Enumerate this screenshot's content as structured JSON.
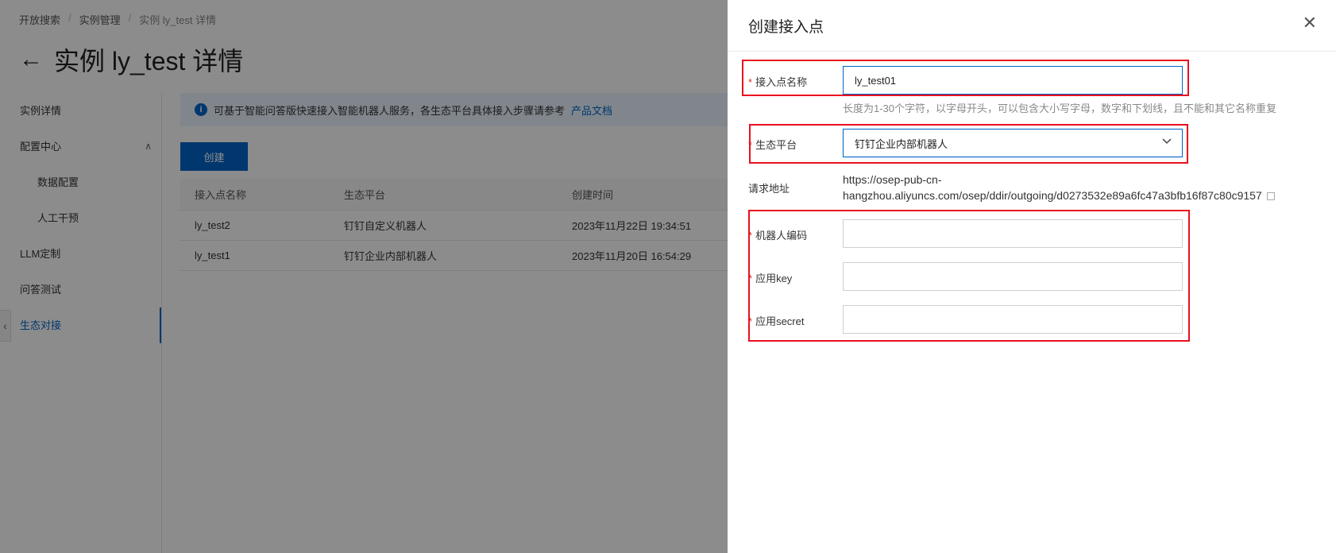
{
  "breadcrumb": [
    "开放搜索",
    "实例管理",
    "实例 ly_test 详情"
  ],
  "page_title": "实例 ly_test 详情",
  "sidebar": {
    "items": [
      {
        "label": "实例详情"
      },
      {
        "label": "配置中心"
      },
      {
        "label": "数据配置"
      },
      {
        "label": "人工干预"
      },
      {
        "label": "LLM定制"
      },
      {
        "label": "问答测试"
      },
      {
        "label": "生态对接"
      }
    ]
  },
  "notice": {
    "text": "可基于智能问答版快速接入智能机器人服务，各生态平台具体接入步骤请参考",
    "link": "产品文档"
  },
  "create_button": "创建",
  "table": {
    "headers": [
      "接入点名称",
      "生态平台",
      "创建时间"
    ],
    "rows": [
      [
        "ly_test2",
        "钉钉自定义机器人",
        "2023年11月22日 19:34:51"
      ],
      [
        "ly_test1",
        "钉钉企业内部机器人",
        "2023年11月20日 16:54:29"
      ]
    ]
  },
  "drawer": {
    "title": "创建接入点",
    "name_label": "接入点名称",
    "name_value": "ly_test01",
    "name_hint": "长度为1-30个字符，以字母开头，可以包含大小写字母，数字和下划线，且不能和其它名称重复",
    "platform_label": "生态平台",
    "platform_value": "钉钉企业内部机器人",
    "url_label": "请求地址",
    "url_value": "https://osep-pub-cn-hangzhou.aliyuncs.com/osep/ddir/outgoing/d0273532e89a6fc47a3bfb16f87c80c9157",
    "robot_code_label": "机器人编码",
    "app_key_label": "应用key",
    "app_secret_label": "应用secret",
    "required_mark": "*"
  },
  "colors": {
    "accent": "#0064c8",
    "highlight_box": "#e8101f",
    "required": "#d93026"
  }
}
